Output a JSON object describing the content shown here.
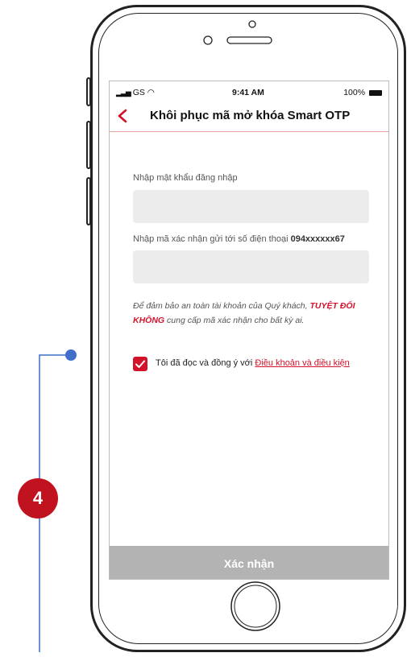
{
  "status_bar": {
    "carrier": "GS",
    "time": "9:41 AM",
    "battery": "100%"
  },
  "nav": {
    "back_icon": "chevron-left-icon",
    "title": "Khôi phục mã mở khóa Smart OTP"
  },
  "form": {
    "password_label": "Nhập mật khẩu đăng nhập",
    "password_value": "",
    "otp_label_prefix": "Nhập mã xác nhận gửi tới số điện thoại ",
    "otp_label_phone": "094xxxxxx67",
    "otp_value": ""
  },
  "notice": {
    "part1": "Để đảm bảo an toàn tài khoản của Quý khách, ",
    "emphasis": "TUYỆT ĐỐI KHÔNG",
    "part2": " cung cấp mã xác nhận cho bất kỳ ai."
  },
  "terms": {
    "checked": true,
    "text": "Tôi đã đọc và đồng ý với ",
    "link": "Điều khoản và điều kiện"
  },
  "confirm_label": "Xác nhận",
  "annotation": {
    "number": "4"
  },
  "colors": {
    "accent": "#d3122a",
    "annotation_badge": "#c1121f",
    "annotation_line": "#3f6fc9",
    "input_bg": "#ececec",
    "button_disabled": "#b3b3b3"
  }
}
